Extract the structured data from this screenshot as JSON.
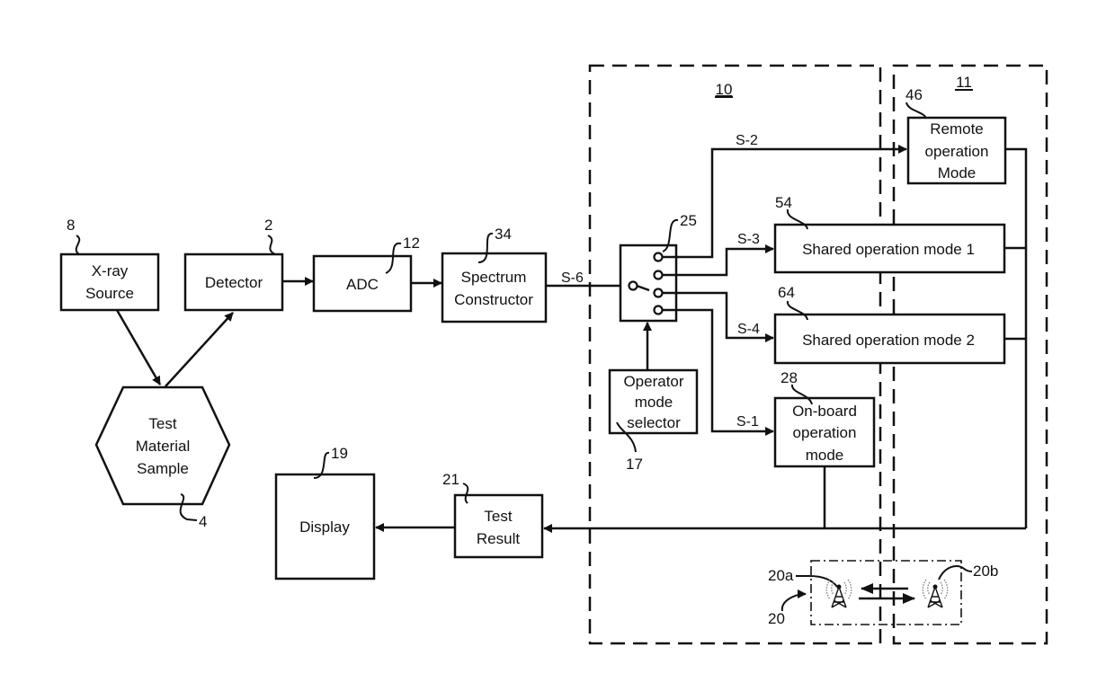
{
  "diagram": {
    "blocks": {
      "xray_source": {
        "label": [
          "X-ray",
          "Source"
        ],
        "ref": "8"
      },
      "detector": {
        "label": [
          "Detector"
        ],
        "ref": "2"
      },
      "adc": {
        "label": [
          "ADC"
        ],
        "ref": "12"
      },
      "spectrum_constructor": {
        "label": [
          "Spectrum",
          "Constructor"
        ],
        "ref": "34"
      },
      "test_sample": {
        "label": [
          "Test",
          "Material",
          "Sample"
        ],
        "ref": "4"
      },
      "switch": {
        "ref": "25"
      },
      "operator_mode_selector": {
        "label": [
          "Operator",
          "mode",
          "selector"
        ],
        "ref": "17"
      },
      "remote_operation": {
        "label": [
          "Remote",
          "operation",
          "Mode"
        ],
        "ref": "46"
      },
      "shared_mode_1": {
        "label": [
          "Shared operation mode 1"
        ],
        "ref": "54"
      },
      "shared_mode_2": {
        "label": [
          "Shared operation mode 2"
        ],
        "ref": "64"
      },
      "onboard_operation": {
        "label": [
          "On-board",
          "operation",
          "mode"
        ],
        "ref": "28"
      },
      "test_result": {
        "label": [
          "Test",
          "Result"
        ],
        "ref": "21"
      },
      "display": {
        "label": [
          "Display"
        ],
        "ref": "19"
      }
    },
    "signals": {
      "s6": "S-6",
      "s2": "S-2",
      "s3": "S-3",
      "s4": "S-4",
      "s1": "S-1"
    },
    "regions": {
      "device": "10",
      "remote": "11"
    },
    "wireless": {
      "group_ref": "20",
      "antenna_a_ref": "20a",
      "antenna_b_ref": "20b"
    }
  }
}
